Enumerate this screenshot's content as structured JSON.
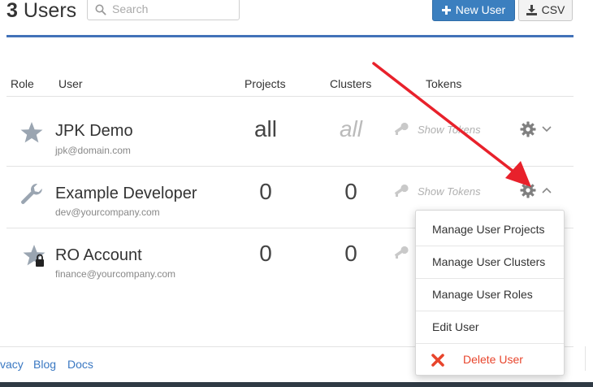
{
  "header": {
    "count": "3",
    "title_suffix": "Users",
    "search_placeholder": "Search",
    "new_user_label": "New User",
    "csv_label": "CSV"
  },
  "table": {
    "columns": [
      "Role",
      "User",
      "Projects",
      "Clusters",
      "Tokens"
    ],
    "rows": [
      {
        "role_icon": "star-icon",
        "name": "JPK Demo",
        "email": "jpk@domain.com",
        "projects": "all",
        "clusters": "all",
        "tokens_label": "Show Tokens",
        "actions_open": false
      },
      {
        "role_icon": "wrench-icon",
        "name": "Example Developer",
        "email": "dev@yourcompany.com",
        "projects": "0",
        "clusters": "0",
        "tokens_label": "Show Tokens",
        "actions_open": true
      },
      {
        "role_icon": "star-lock-icon",
        "name": "RO Account",
        "email": "finance@yourcompany.com",
        "projects": "0",
        "clusters": "0",
        "tokens_label": "",
        "actions_open": false
      }
    ]
  },
  "actions_menu": {
    "items": [
      "Manage User Projects",
      "Manage User Clusters",
      "Manage User Roles",
      "Edit User"
    ],
    "delete_label": "Delete User"
  },
  "footer": {
    "links": [
      "vacy",
      "Blog",
      "Docs"
    ]
  },
  "colors": {
    "accent": "#3b7fbf",
    "rule": "#4272b8",
    "danger": "#e8452c",
    "annotation_arrow": "#e8212b"
  }
}
